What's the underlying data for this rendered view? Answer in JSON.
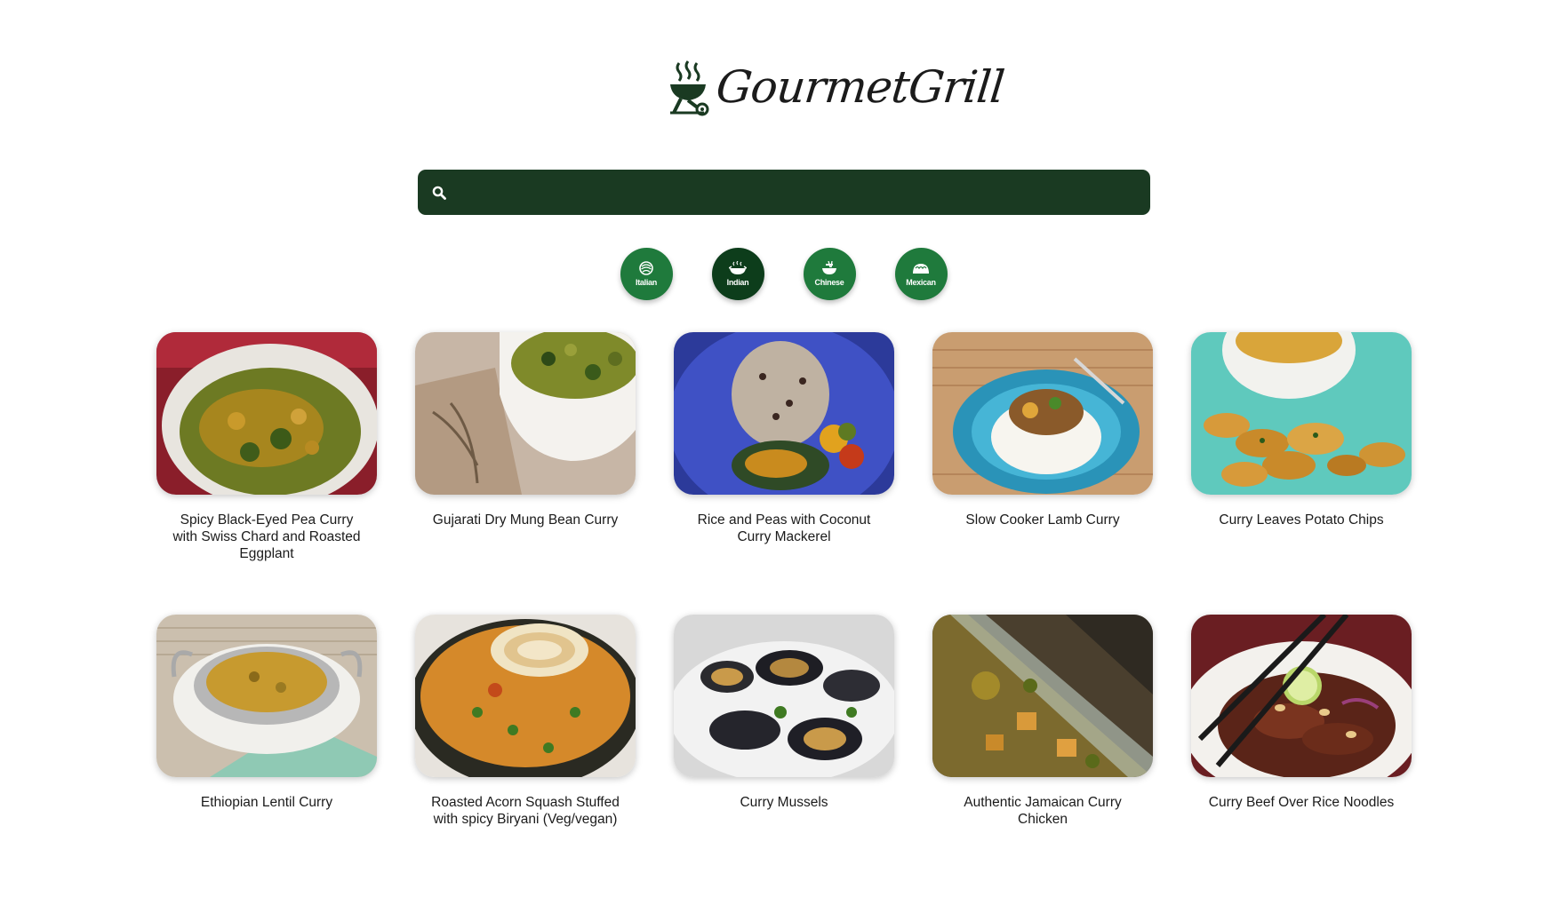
{
  "brand": {
    "name": "GourmetGrill",
    "logo_icon": "grill-icon"
  },
  "search": {
    "value": "",
    "placeholder": "",
    "icon": "search-icon"
  },
  "cuisines": [
    {
      "label": "Italian",
      "icon": "pasta-icon",
      "active": false
    },
    {
      "label": "Indian",
      "icon": "curry-icon",
      "active": true
    },
    {
      "label": "Chinese",
      "icon": "noodle-bowl-icon",
      "active": false
    },
    {
      "label": "Mexican",
      "icon": "taco-icon",
      "active": false
    }
  ],
  "colors": {
    "brand_dark": "#1a3a22",
    "cuisine_button": "#1f7a3c",
    "cuisine_button_active": "#0d3d1b"
  },
  "recipes": [
    {
      "title": "Spicy Black-Eyed Pea Curry with Swiss Chard and Roasted Eggplant"
    },
    {
      "title": "Gujarati Dry Mung Bean Curry"
    },
    {
      "title": "Rice and Peas with Coconut Curry Mackerel"
    },
    {
      "title": "Slow Cooker Lamb Curry"
    },
    {
      "title": "Curry Leaves Potato Chips"
    },
    {
      "title": "Ethiopian Lentil Curry"
    },
    {
      "title": "Roasted Acorn Squash Stuffed with spicy Biryani (Veg/vegan)"
    },
    {
      "title": "Curry Mussels"
    },
    {
      "title": "Authentic Jamaican Curry Chicken"
    },
    {
      "title": "Curry Beef Over Rice Noodles"
    }
  ]
}
